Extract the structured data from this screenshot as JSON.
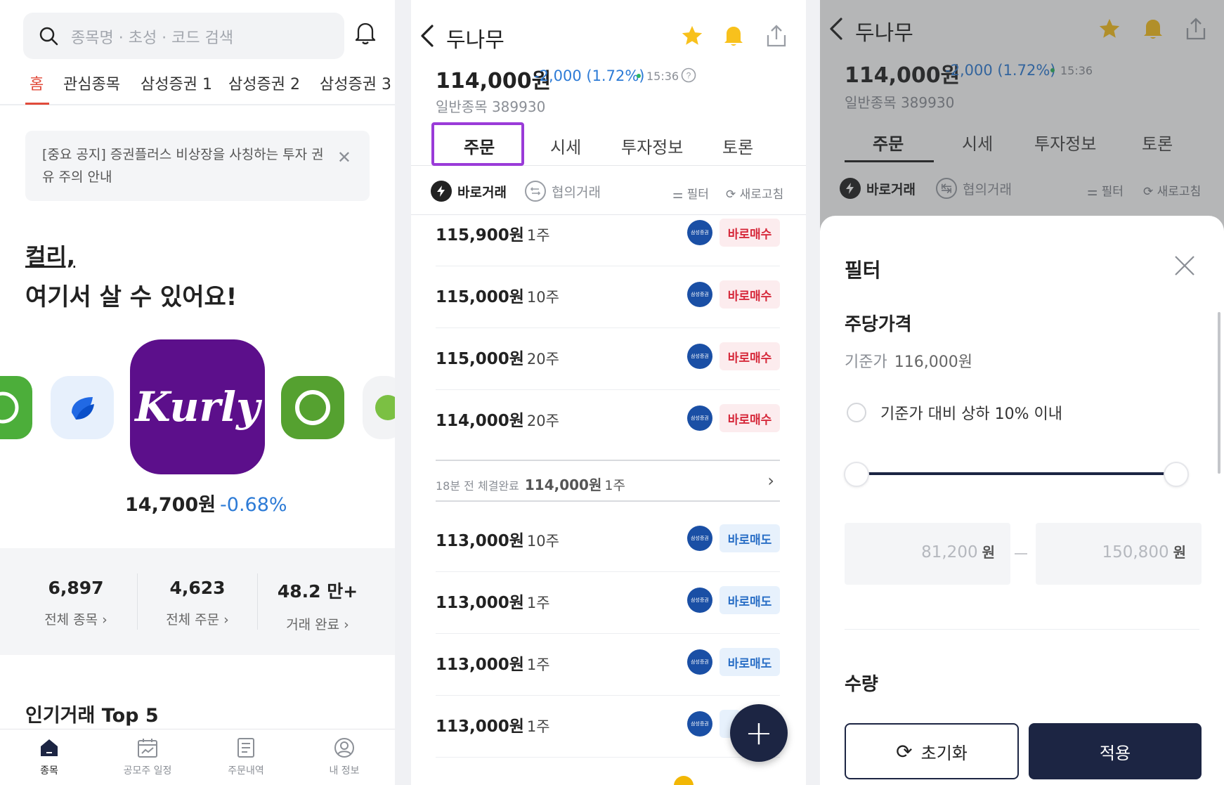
{
  "home": {
    "search_placeholder": "종목명 · 초성 · 코드 검색",
    "tabs": [
      "홈",
      "관심종목",
      "삼성증권 1",
      "삼성증권 2",
      "삼성증권 3"
    ],
    "notice": "[중요 공지] 증권플러스 비상장을 사칭하는 투자 권유 주의 안내",
    "promo_brand": "컬리,",
    "promo_title": "여기서 살 수 있어요!",
    "promo_logo_text": "Kurly",
    "promo_price": "14,700원",
    "promo_change": "-0.68%",
    "stats": [
      {
        "value": "6,897",
        "label": "전체 종목 ›"
      },
      {
        "value": "4,623",
        "label": "전체 주문 ›"
      },
      {
        "value": "48.2 만+",
        "label": "거래 완료 ›"
      }
    ],
    "top5_title": "인기거래 Top 5",
    "bottom_nav": [
      "종목",
      "공모주 일정",
      "주문내역",
      "내 정보"
    ]
  },
  "stock": {
    "name": "두나무",
    "price": "114,000원",
    "change": "-2,000 (1.72%)",
    "time": "15:36",
    "market_code": "일반종목 389930",
    "tabs": [
      "주문",
      "시세",
      "투자정보",
      "토론"
    ],
    "trade_modes": [
      "바로거래",
      "협의거래"
    ],
    "filter_label": "필터",
    "refresh_label": "새로고침",
    "broker_badge": "삼성증권",
    "buy_orders": [
      {
        "price": "115,900원",
        "qty": "1주",
        "action": "바로매수"
      },
      {
        "price": "115,000원",
        "qty": "10주",
        "action": "바로매수"
      },
      {
        "price": "115,000원",
        "qty": "20주",
        "action": "바로매수"
      },
      {
        "price": "114,000원",
        "qty": "20주",
        "action": "바로매수"
      }
    ],
    "recent_trade": {
      "label": "18분 전 체결완료",
      "price": "114,000원",
      "qty": "1주"
    },
    "sell_orders": [
      {
        "price": "113,000원",
        "qty": "10주",
        "action": "바로매도"
      },
      {
        "price": "113,000원",
        "qty": "1주",
        "action": "바로매도"
      },
      {
        "price": "113,000원",
        "qty": "1주",
        "action": "바로매도"
      },
      {
        "price": "113,000원",
        "qty": "1주",
        "action": ""
      }
    ]
  },
  "filter": {
    "title": "필터",
    "section_price": "주당가격",
    "base_label": "기준가",
    "base_value": "116,000원",
    "radio_label": "기준가 대비 상하 10% 이내",
    "range_min": "81,200",
    "range_max": "150,800",
    "unit": "원",
    "section_qty": "수량",
    "reset_label": "초기화",
    "apply_label": "적용"
  },
  "colors": {
    "accent_red": "#e14b3b",
    "down_blue": "#2d7bd6",
    "navy": "#1c2543",
    "kurly_purple": "#5c0f8b",
    "highlight_purple": "#9a3bd8"
  }
}
